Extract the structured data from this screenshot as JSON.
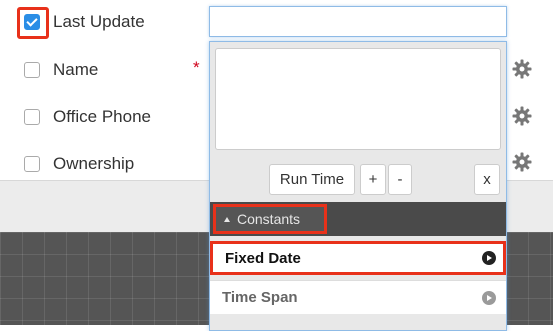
{
  "fields": [
    {
      "label": "Last Update",
      "checked": true
    },
    {
      "label": "Name",
      "checked": false,
      "required": true
    },
    {
      "label": "Office Phone",
      "checked": false
    },
    {
      "label": "Ownership",
      "checked": false
    }
  ],
  "required_marker": "*",
  "toolbar": {
    "run_time_label": "Run Time",
    "plus_label": "+",
    "minus_label": "-",
    "close_label": "x"
  },
  "constants_section": {
    "label": "Constants",
    "items": [
      {
        "label": "Fixed Date",
        "icon": "arrow-circle-right-icon"
      },
      {
        "label": "Time Span",
        "icon": "arrow-circle-right-icon"
      }
    ]
  },
  "colors": {
    "highlight": "#e8311a",
    "checkbox_checked": "#2a8ee6",
    "required_star": "#d0021b"
  }
}
